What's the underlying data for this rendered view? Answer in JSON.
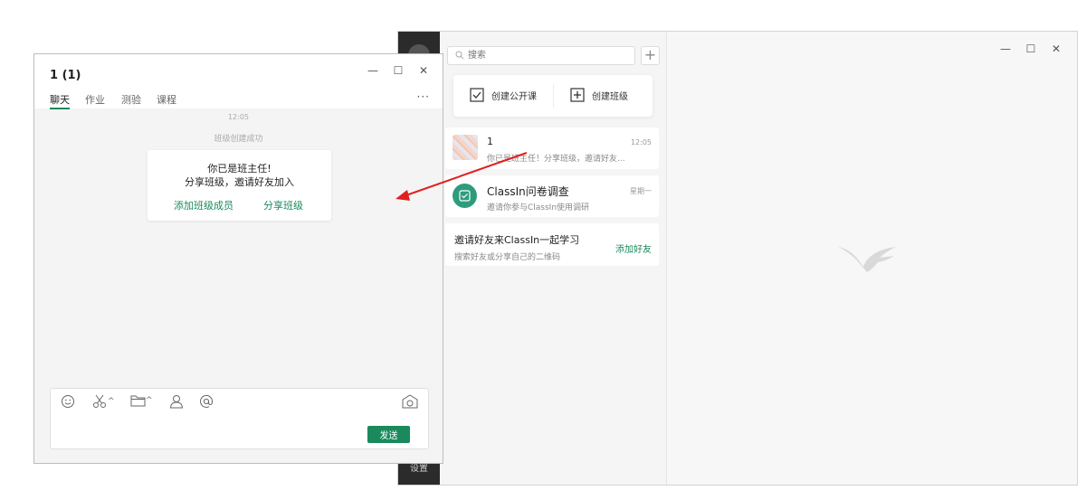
{
  "main_window": {
    "sidebar": {
      "settings_label": "设置"
    },
    "search": {
      "placeholder": "搜索"
    },
    "add_icon": "plus",
    "create_card": {
      "open_class_label": "创建公开课",
      "create_class_label": "创建班级"
    },
    "conversations": [
      {
        "title": "1",
        "preview": "你已是班主任！分享班级，邀请好友...",
        "time": "12:05"
      },
      {
        "title": "ClassIn问卷调查",
        "preview": "邀请你参与ClassIn使用调研",
        "time": "星期一"
      },
      {
        "title": "邀请好友来ClassIn一起学习",
        "preview": "搜索好友或分享自己的二维码",
        "action": "添加好友"
      }
    ],
    "window_controls": {
      "minimize": "—",
      "maximize": "☐",
      "close": "✕"
    }
  },
  "chat_window": {
    "title": "1 (1)",
    "tabs": [
      "聊天",
      "作业",
      "测验",
      "课程"
    ],
    "more": "···",
    "messages": {
      "time": "12:05",
      "system": "班级创建成功"
    },
    "notice_card": {
      "line1": "你已是班主任!",
      "line2": "分享班级，邀请好友加入",
      "add_members": "添加班级成员",
      "share_class": "分享班级"
    },
    "toolbar_chevron": "^",
    "send_label": "发送",
    "window_controls": {
      "minimize": "—",
      "maximize": "☐",
      "close": "✕"
    }
  },
  "colors": {
    "accent": "#1a8a5c",
    "arrow": "#e02020",
    "survey_icon_bg": "#2e9c7c"
  }
}
